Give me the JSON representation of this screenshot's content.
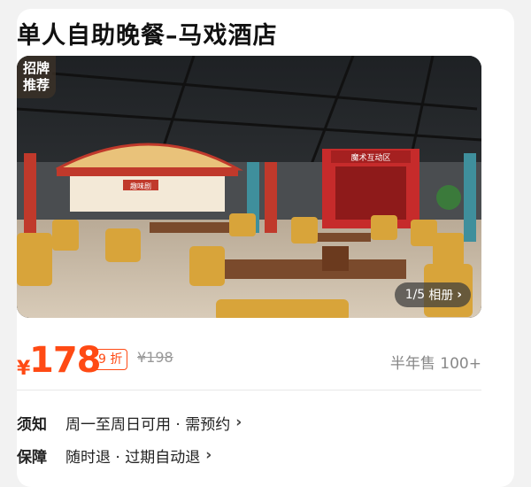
{
  "title": "单人自助晚餐–马戏酒店",
  "photo": {
    "badge_line1": "招牌",
    "badge_line2": "推荐",
    "counter": "1/5",
    "album_label": "相册",
    "sign_left": "趣味剧",
    "sign_right": "魔术互动区"
  },
  "price": {
    "currency": "¥",
    "amount": "178",
    "discount": "9 折",
    "original": "¥198",
    "sold": "半年售 100+"
  },
  "info": {
    "notice_label": "须知",
    "notice_text": "周一至周日可用 · 需预约",
    "guarantee_label": "保障",
    "guarantee_text": "随时退 · 过期自动退"
  },
  "colors": {
    "accent": "#ff4a14",
    "text": "#111111",
    "muted": "#999999"
  }
}
